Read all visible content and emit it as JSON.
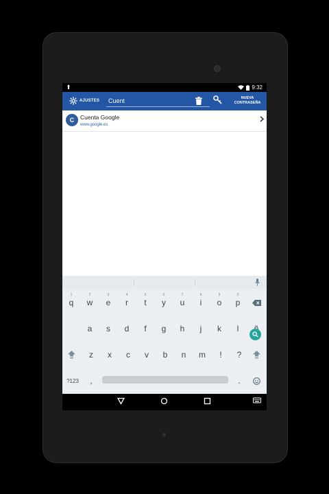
{
  "status_bar": {
    "time": "9:32"
  },
  "app_bar": {
    "settings_label": "AJUSTES",
    "search_value": "Cuent",
    "new_password_line1": "NUEVA",
    "new_password_line2": "CONTRASEÑA"
  },
  "list": {
    "items": [
      {
        "initial": "C",
        "title": "Cuenta Google",
        "subtitle": "www.google.es"
      }
    ]
  },
  "keyboard": {
    "row1": [
      {
        "key": "q",
        "hint": "1"
      },
      {
        "key": "w",
        "hint": "2"
      },
      {
        "key": "e",
        "hint": "3"
      },
      {
        "key": "r",
        "hint": "4"
      },
      {
        "key": "t",
        "hint": "5"
      },
      {
        "key": "y",
        "hint": "6"
      },
      {
        "key": "u",
        "hint": "7"
      },
      {
        "key": "i",
        "hint": "8"
      },
      {
        "key": "o",
        "hint": "9"
      },
      {
        "key": "p",
        "hint": "0"
      }
    ],
    "row2": [
      "a",
      "s",
      "d",
      "f",
      "g",
      "h",
      "j",
      "k",
      "l",
      "ñ"
    ],
    "row3": [
      "z",
      "x",
      "c",
      "v",
      "b",
      "n",
      "m",
      "!",
      "?"
    ],
    "symbols_label": "?123",
    "comma": ",",
    "period": "."
  },
  "colors": {
    "app_bar": "#2456a6",
    "accent_key": "#26a69a",
    "link": "#2a5fb0"
  }
}
